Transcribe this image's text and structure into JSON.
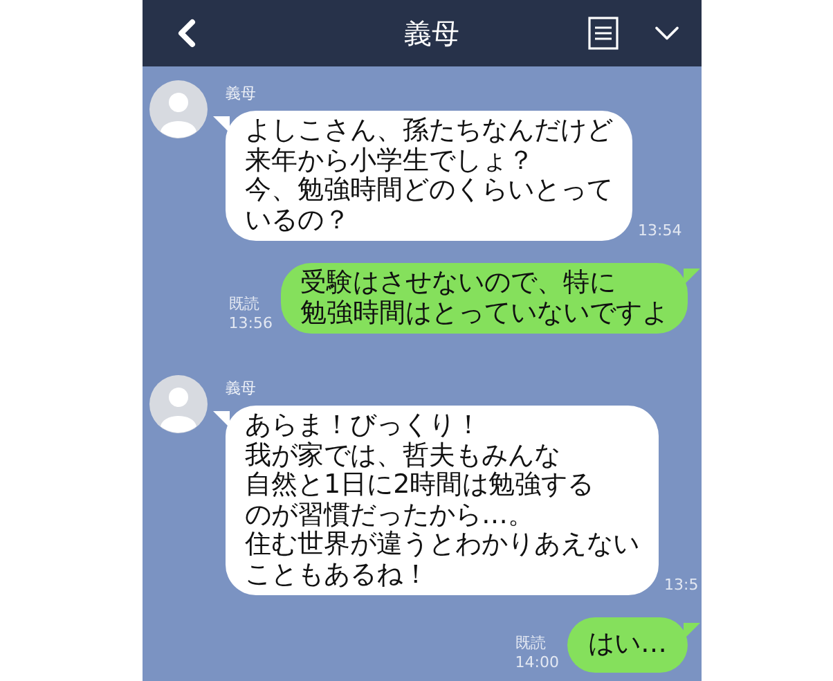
{
  "header": {
    "title": "義母"
  },
  "messages": [
    {
      "kind": "incoming",
      "sender": "義母",
      "lines": [
        "よしこさん、孫たちなんだけど",
        "来年から小学生でしょ？",
        "今、勉強時間どのくらいとって",
        "いるの？"
      ],
      "time": "13:54"
    },
    {
      "kind": "outgoing",
      "read_label": "既読",
      "lines": [
        "受験はさせないので、特に",
        "勉強時間はとっていないですよ"
      ],
      "time": "13:56"
    },
    {
      "kind": "incoming",
      "sender": "義母",
      "lines": [
        "あらま！びっくり！",
        "我が家では、哲夫もみんな",
        "自然と1日に2時間は勉強する",
        "のが習慣だったから…。",
        "住む世界が違うとわかりあえない",
        "こともあるね！"
      ],
      "time": "13:5"
    },
    {
      "kind": "outgoing",
      "read_label": "既読",
      "lines": [
        "はい…"
      ],
      "time": "14:00"
    }
  ]
}
